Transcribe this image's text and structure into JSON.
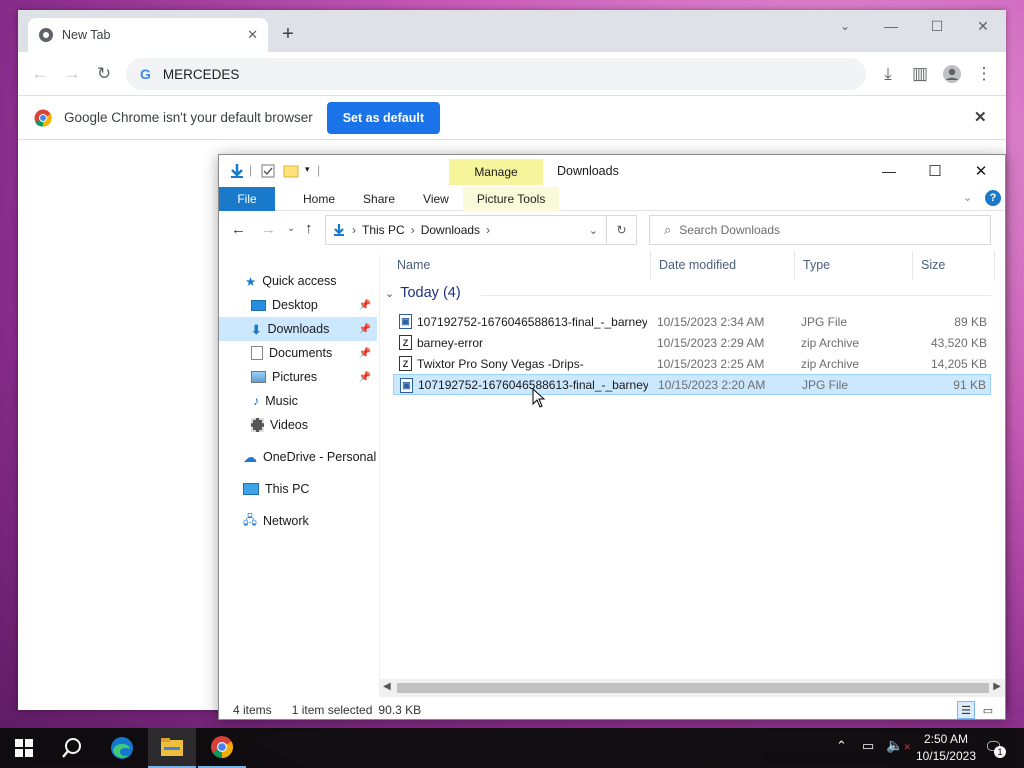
{
  "chrome": {
    "tab_title": "New Tab",
    "omnibox_text": "MERCEDES",
    "infobar_text": "Google Chrome isn't your default browser",
    "set_default_label": "Set as default"
  },
  "explorer": {
    "manage_label": "Manage",
    "window_title": "Downloads",
    "ribbon_tabs": [
      "File",
      "Home",
      "Share",
      "View",
      "Picture Tools"
    ],
    "breadcrumb": [
      "This PC",
      "Downloads"
    ],
    "search_placeholder": "Search Downloads",
    "nav": {
      "quick_access": "Quick access",
      "desktop": "Desktop",
      "downloads": "Downloads",
      "documents": "Documents",
      "pictures": "Pictures",
      "music": "Music",
      "videos": "Videos",
      "onedrive": "OneDrive - Personal",
      "thispc": "This PC",
      "network": "Network"
    },
    "columns": {
      "name": "Name",
      "date": "Date modified",
      "type": "Type",
      "size": "Size"
    },
    "group_label": "Today (4)",
    "files": [
      {
        "name": "107192752-1676046588613-final_-_barney...",
        "date": "10/15/2023 2:34 AM",
        "type": "JPG File",
        "size": "89 KB",
        "icon": "image"
      },
      {
        "name": "barney-error",
        "date": "10/15/2023 2:29 AM",
        "type": "zip Archive",
        "size": "43,520 KB",
        "icon": "zip"
      },
      {
        "name": "Twixtor Pro Sony Vegas -Drips-",
        "date": "10/15/2023 2:25 AM",
        "type": "zip Archive",
        "size": "14,205 KB",
        "icon": "zip"
      },
      {
        "name": "107192752-1676046588613-final_-_barney...",
        "date": "10/15/2023 2:20 AM",
        "type": "JPG File",
        "size": "91 KB",
        "icon": "image"
      }
    ],
    "status": {
      "items": "4 items",
      "selected": "1 item selected",
      "size": "90.3 KB"
    }
  },
  "taskbar": {
    "time": "2:50 AM",
    "date": "10/15/2023",
    "notification_count": "1"
  },
  "colors": {
    "chrome_blue": "#1a73e8",
    "selection": "#cce8ff",
    "manage_yellow": "#f7f59b",
    "file_tab": "#1979ca"
  }
}
